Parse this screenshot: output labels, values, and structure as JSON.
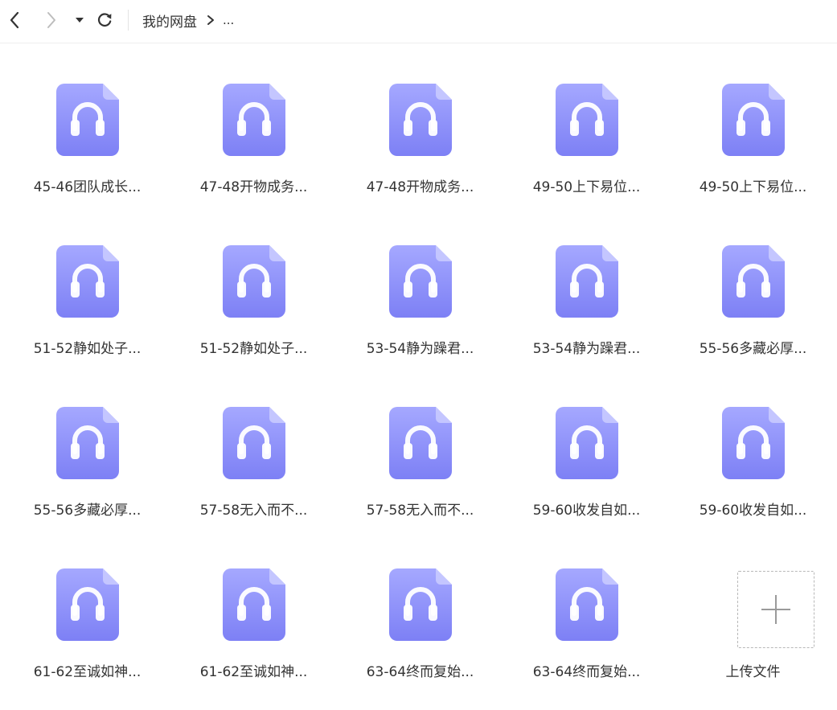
{
  "toolbar": {
    "back_icon": "chevron-left-icon",
    "forward_icon": "chevron-right-icon",
    "history_icon": "caret-down-icon",
    "refresh_icon": "refresh-icon"
  },
  "breadcrumb": {
    "home": "我的网盘",
    "separator_icon": "chevron-right-icon",
    "more": "..."
  },
  "files": [
    {
      "name": "45-46团队成长...",
      "icon": "audio-file-icon"
    },
    {
      "name": "47-48开物成务...",
      "icon": "audio-file-icon"
    },
    {
      "name": "47-48开物成务...",
      "icon": "audio-file-icon"
    },
    {
      "name": "49-50上下易位...",
      "icon": "audio-file-icon"
    },
    {
      "name": "49-50上下易位...",
      "icon": "audio-file-icon"
    },
    {
      "name": "51-52静如处子...",
      "icon": "audio-file-icon"
    },
    {
      "name": "51-52静如处子...",
      "icon": "audio-file-icon"
    },
    {
      "name": "53-54静为躁君...",
      "icon": "audio-file-icon"
    },
    {
      "name": "53-54静为躁君...",
      "icon": "audio-file-icon"
    },
    {
      "name": "55-56多藏必厚...",
      "icon": "audio-file-icon"
    },
    {
      "name": "55-56多藏必厚...",
      "icon": "audio-file-icon"
    },
    {
      "name": "57-58无入而不...",
      "icon": "audio-file-icon"
    },
    {
      "name": "57-58无入而不...",
      "icon": "audio-file-icon"
    },
    {
      "name": "59-60收发自如...",
      "icon": "audio-file-icon"
    },
    {
      "name": "59-60收发自如...",
      "icon": "audio-file-icon"
    },
    {
      "name": "61-62至诚如神...",
      "icon": "audio-file-icon"
    },
    {
      "name": "61-62至诚如神...",
      "icon": "audio-file-icon"
    },
    {
      "name": "63-64终而复始...",
      "icon": "audio-file-icon"
    },
    {
      "name": "63-64终而复始...",
      "icon": "audio-file-icon"
    }
  ],
  "upload": {
    "label": "上传文件",
    "icon": "plus-icon"
  },
  "colors": {
    "file_icon_top": "#a3a6ff",
    "file_icon_bottom": "#7f82f6",
    "file_icon_fold": "#c2c4ff",
    "headphone": "#ffffff",
    "text": "#333333",
    "divider": "#eeeeee",
    "upload_border": "#b8b8b8",
    "upload_plus": "#9a9a9a"
  }
}
